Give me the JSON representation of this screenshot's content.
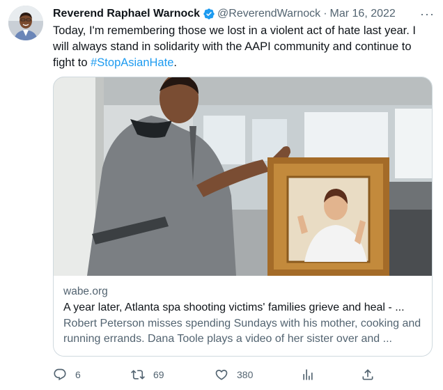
{
  "tweet": {
    "author_name": "Reverend Raphael Warnock",
    "handle": "@ReverendWarnock",
    "separator": "·",
    "date": "Mar 16, 2022",
    "more_label": "···",
    "text_before": "Today, I'm remembering those we lost in a violent act of hate last year. I will always stand in solidarity with the AAPI community and continue to fight to ",
    "hashtag": "#StopAsianHate",
    "text_after": "."
  },
  "card": {
    "domain": "wabe.org",
    "title": "A year later, Atlanta spa shooting victims' families grieve and heal - ...",
    "description": "Robert Peterson misses spending Sundays with his mother, cooking and running errands. Dana Toole plays a video of her sister over and ..."
  },
  "actions": {
    "replies": "6",
    "retweets": "69",
    "likes": "380"
  },
  "icons": {
    "verified": "verified-badge-icon",
    "reply": "reply-icon",
    "retweet": "retweet-icon",
    "like": "heart-icon",
    "views": "views-icon",
    "share": "share-icon"
  },
  "colors": {
    "accent": "#1d9bf0",
    "secondary_text": "#536471",
    "border": "#cfd9de"
  }
}
